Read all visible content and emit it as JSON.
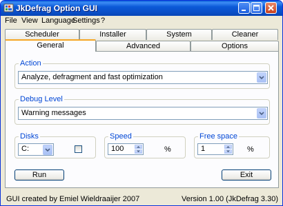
{
  "window": {
    "title": "JkDefrag Option GUI"
  },
  "menu": [
    "File",
    "View",
    "Language",
    "Settings",
    "?"
  ],
  "tabs_back": [
    "Scheduler",
    "Installer",
    "System",
    "Cleaner"
  ],
  "tabs_front": [
    "General",
    "Advanced",
    "Options"
  ],
  "active_tab": "General",
  "action": {
    "label": "Action",
    "value": "Analyze, defragment and fast optimization"
  },
  "debug": {
    "label": "Debug Level",
    "value": "Warning messages"
  },
  "disks": {
    "label": "Disks",
    "value": "C:",
    "checkbox_checked": false
  },
  "speed": {
    "label": "Speed",
    "value": "100",
    "unit": "%"
  },
  "free_space": {
    "label": "Free space",
    "value": "1",
    "unit": "%"
  },
  "buttons": {
    "run": "Run",
    "exit": "Exit"
  },
  "status": {
    "credit": "GUI created by Emiel Wieldraaijer 2007",
    "version": "Version 1.00 (JkDefrag 3.30)"
  }
}
